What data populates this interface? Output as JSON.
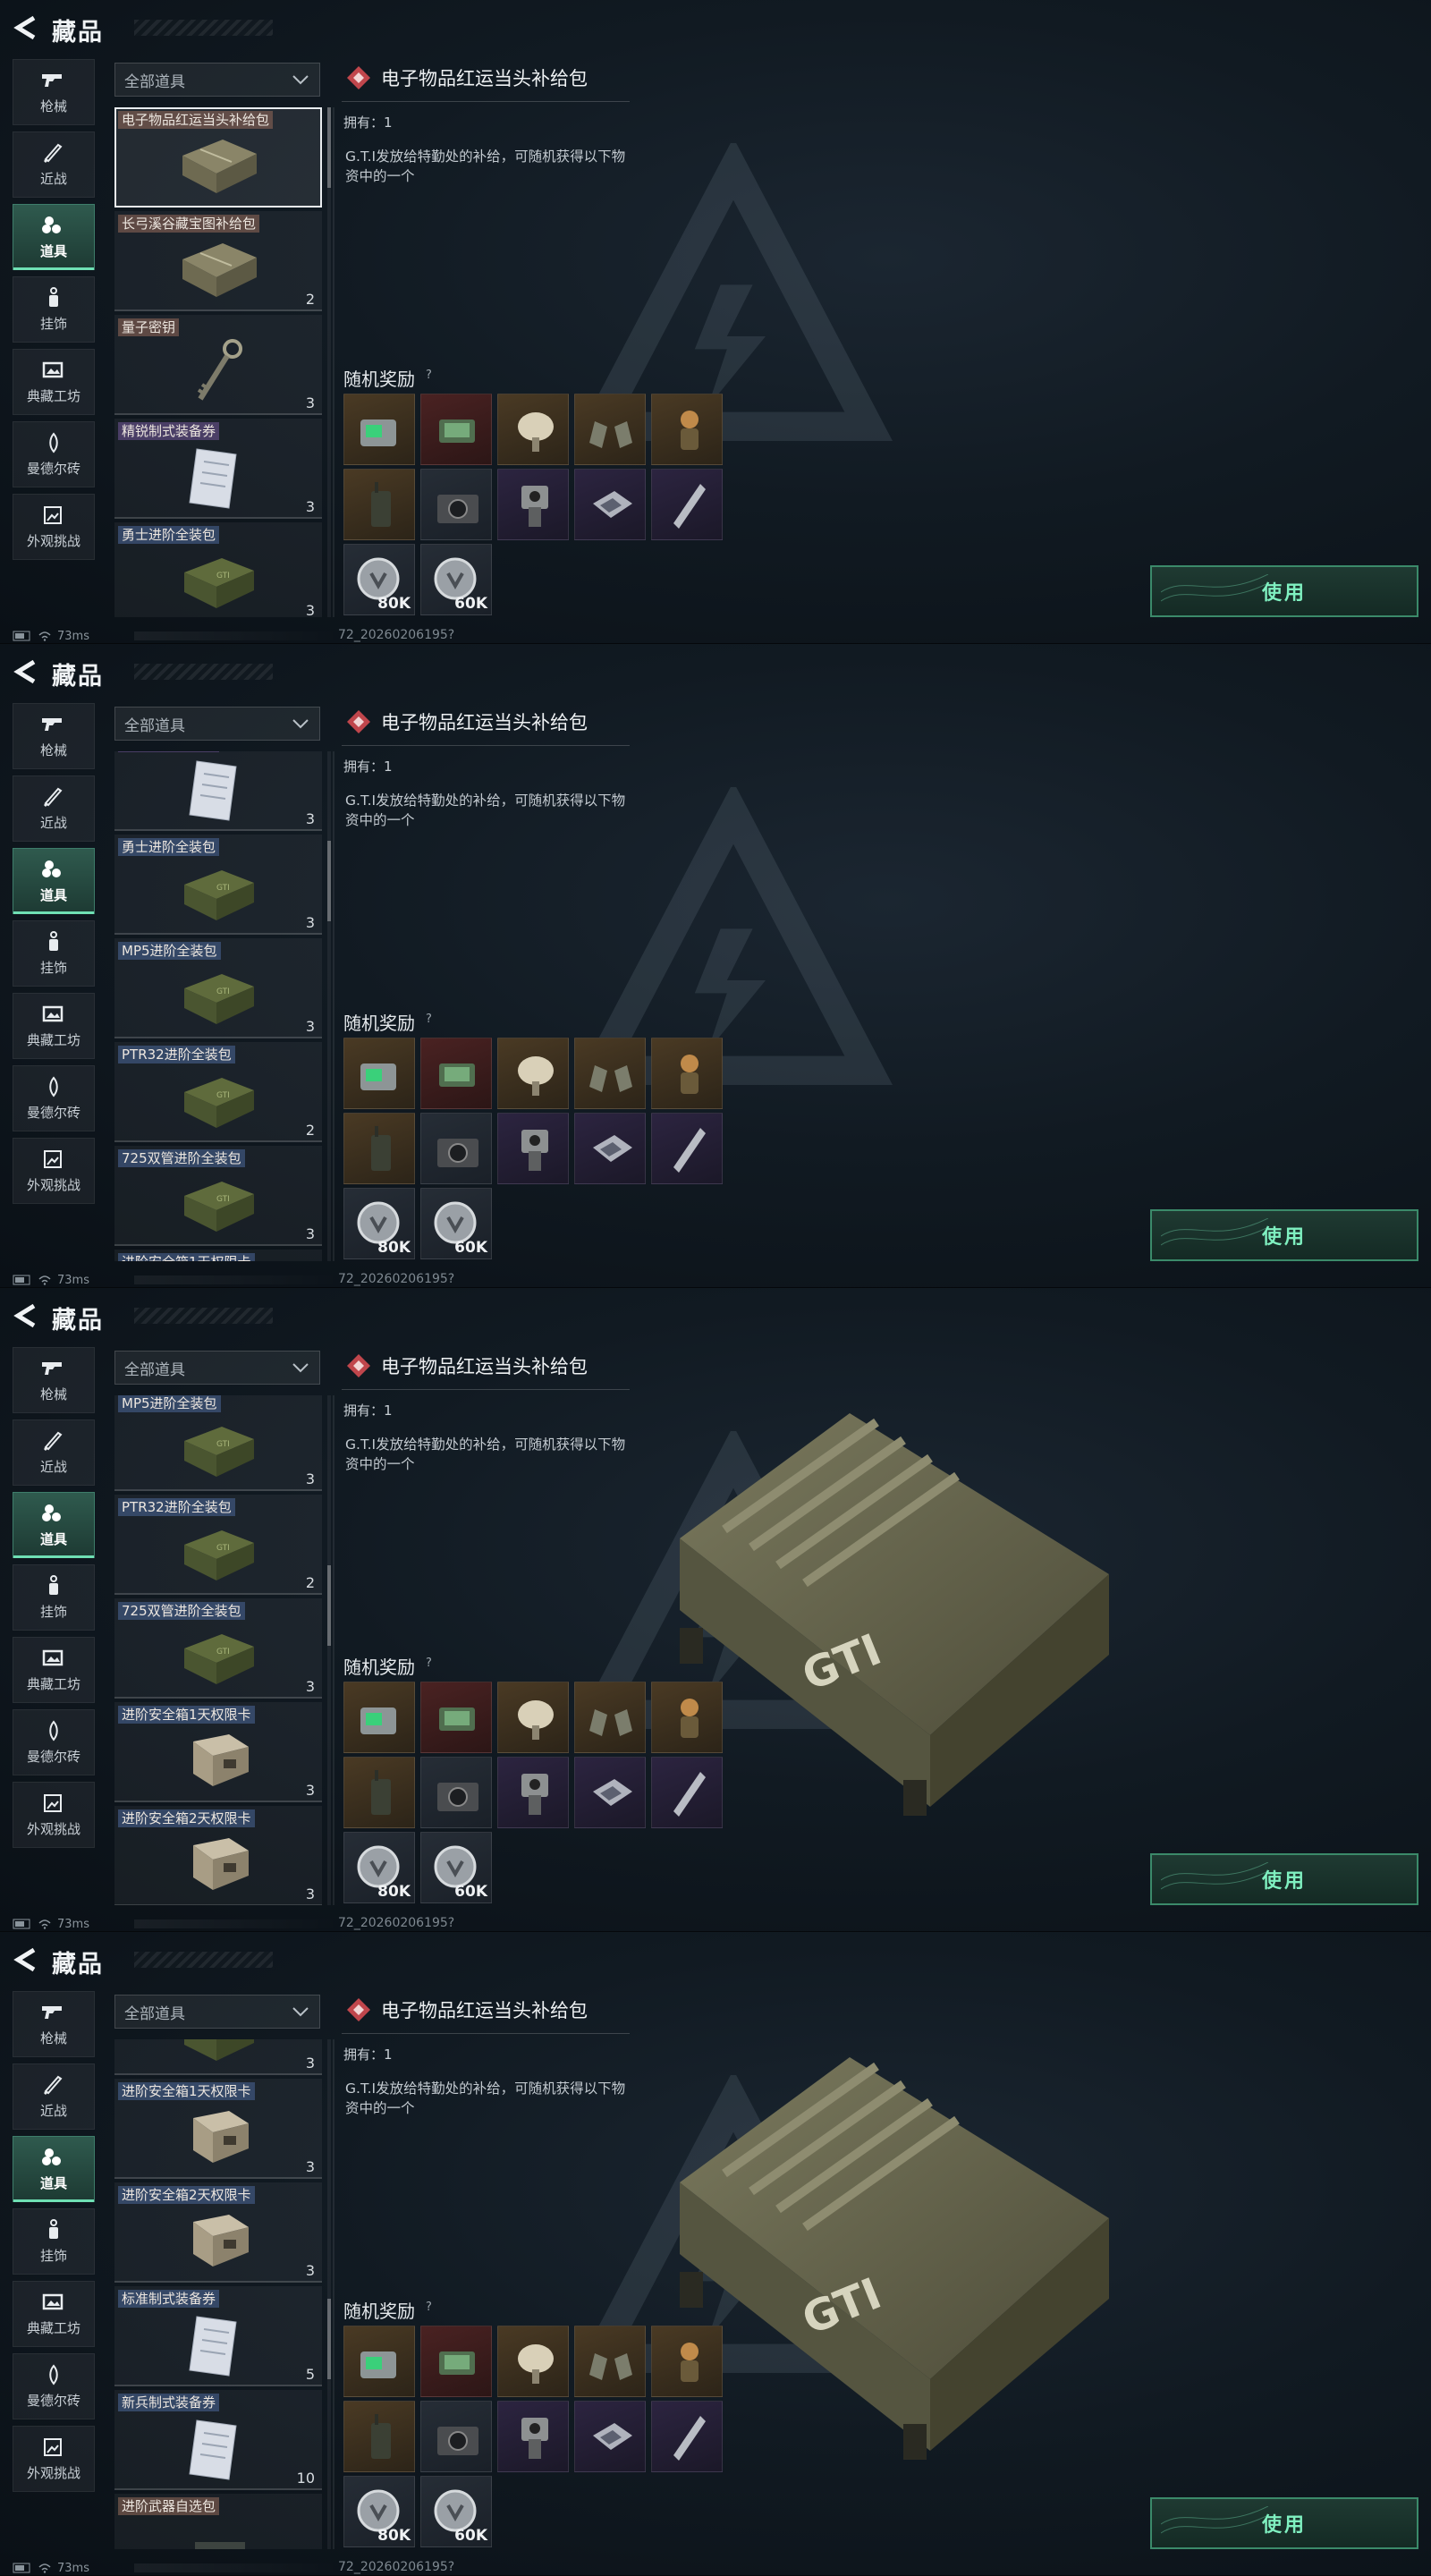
{
  "page_title": "藏品",
  "categories": [
    {
      "label": "枪械",
      "icon": "gun-icon"
    },
    {
      "label": "近战",
      "icon": "knife-icon"
    },
    {
      "label": "道具",
      "icon": "items-icon",
      "active": true
    },
    {
      "label": "挂饰",
      "icon": "charm-icon"
    },
    {
      "label": "典藏工坊",
      "icon": "gallery-icon"
    },
    {
      "label": "曼德尔砖",
      "icon": "brick-icon"
    },
    {
      "label": "外观挑战",
      "icon": "challenge-icon"
    }
  ],
  "filter": {
    "label": "全部道具"
  },
  "detail": {
    "title": "电子物品红运当头补给包",
    "owned": "拥有：1",
    "description": "G.T.I发放给特勤处的补给，可随机获得以下物资中的一个",
    "reward_title": "随机奖励",
    "reward_help": "?",
    "rewards": [
      {
        "icon": "device-icon",
        "rarity": "brown",
        "value": ""
      },
      {
        "icon": "circuit-board-icon",
        "rarity": "red",
        "value": ""
      },
      {
        "icon": "satellite-dish-icon",
        "rarity": "brown",
        "value": ""
      },
      {
        "icon": "binoculars-icon",
        "rarity": "brown",
        "value": ""
      },
      {
        "icon": "figurine-icon",
        "rarity": "brown",
        "value": ""
      },
      {
        "icon": "radio-icon",
        "rarity": "brown",
        "value": ""
      },
      {
        "icon": "camera-icon",
        "rarity": "dark",
        "value": ""
      },
      {
        "icon": "sensor-icon",
        "rarity": "purple",
        "value": ""
      },
      {
        "icon": "chip-icon",
        "rarity": "purple",
        "value": ""
      },
      {
        "icon": "stick-icon",
        "rarity": "purple",
        "value": ""
      },
      {
        "icon": "coin-icon",
        "rarity": "dark",
        "value": "80K"
      },
      {
        "icon": "coin-icon",
        "rarity": "dark",
        "value": "60K"
      }
    ],
    "use_label": "使用"
  },
  "status": {
    "ping": "73ms",
    "session_id": "72_20260206195?"
  },
  "items": [
    {
      "name": "电子物品红运当头补给包",
      "count": "",
      "tag": "brown",
      "icon": "supply-crate-icon"
    },
    {
      "name": "长弓溪谷藏宝图补给包",
      "count": "2",
      "tag": "brown",
      "icon": "supply-crate-icon"
    },
    {
      "name": "量子密钥",
      "count": "3",
      "tag": "brown",
      "icon": "quantum-key-icon"
    },
    {
      "name": "精锐制式装备券",
      "count": "3",
      "tag": "purple",
      "icon": "voucher-icon"
    },
    {
      "name": "勇士进阶全装包",
      "count": "3",
      "tag": "blue",
      "icon": "gear-crate-icon"
    },
    {
      "name": "MP5进阶全装包",
      "count": "3",
      "tag": "blue",
      "icon": "gear-crate-icon"
    },
    {
      "name": "PTR32进阶全装包",
      "count": "2",
      "tag": "blue",
      "icon": "gear-crate-icon"
    },
    {
      "name": "725双管进阶全装包",
      "count": "3",
      "tag": "blue",
      "icon": "gear-crate-icon"
    },
    {
      "name": "进阶安全箱1天权限卡",
      "count": "3",
      "tag": "blue",
      "icon": "safe-box-icon"
    },
    {
      "name": "进阶安全箱2天权限卡",
      "count": "3",
      "tag": "blue",
      "icon": "safe-box-icon"
    },
    {
      "name": "标准制式装备券",
      "count": "5",
      "tag": "blue",
      "icon": "voucher-icon"
    },
    {
      "name": "新兵制式装备券",
      "count": "10",
      "tag": "blue",
      "icon": "voucher-icon"
    },
    {
      "name": "进阶武器自选包",
      "count": "",
      "tag": "none",
      "icon": "weapon-pack-icon"
    }
  ],
  "frames": [
    {
      "scroll_items": 0,
      "show_preview": false
    },
    {
      "scroll_items": 3.2,
      "show_preview": false
    },
    {
      "scroll_items": 5.04,
      "show_preview": true
    },
    {
      "scroll_items": 7.62,
      "show_preview": true
    }
  ]
}
